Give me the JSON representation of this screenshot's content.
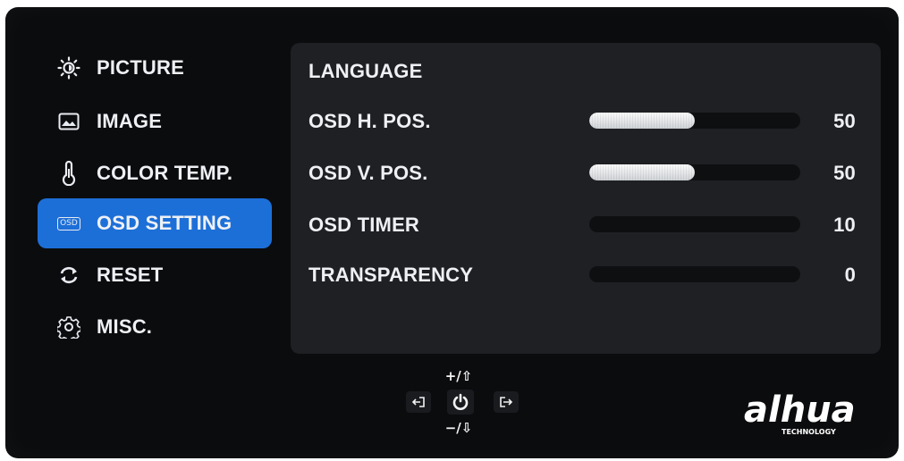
{
  "sidebar": {
    "items": [
      {
        "label": "PICTURE",
        "icon": "brightness-icon",
        "active": false
      },
      {
        "label": "IMAGE",
        "icon": "image-icon",
        "active": false
      },
      {
        "label": "COLOR TEMP.",
        "icon": "thermometer-icon",
        "active": false
      },
      {
        "label": "OSD SETTING",
        "icon": "osd-icon",
        "active": true
      },
      {
        "label": "RESET",
        "icon": "reset-icon",
        "active": false
      },
      {
        "label": "MISC.",
        "icon": "gear-icon",
        "active": false
      }
    ],
    "osd_icon_text": "OSD"
  },
  "panel": {
    "rows": [
      {
        "label": "LANGUAGE",
        "value": "",
        "level": null
      },
      {
        "label": "OSD H. POS.",
        "value": "50",
        "level": 0.5
      },
      {
        "label": "OSD V. POS.",
        "value": "50",
        "level": 0.5
      },
      {
        "label": "OSD TIMER",
        "value": "10",
        "level": 0
      },
      {
        "label": "TRANSPARENCY",
        "value": "0",
        "level": 0
      }
    ]
  },
  "controls": {
    "up_label": "+/⇧",
    "down_label": "−/⇩",
    "exit_icon": "exit-icon",
    "enter_icon": "enter-icon",
    "power_icon": "power-icon"
  },
  "brand": {
    "logo_text": "alhua",
    "tagline": "TECHNOLOGY"
  },
  "colors": {
    "accent": "#1d6fd8",
    "background": "#0b0c0e",
    "panel": "#1e2023"
  }
}
